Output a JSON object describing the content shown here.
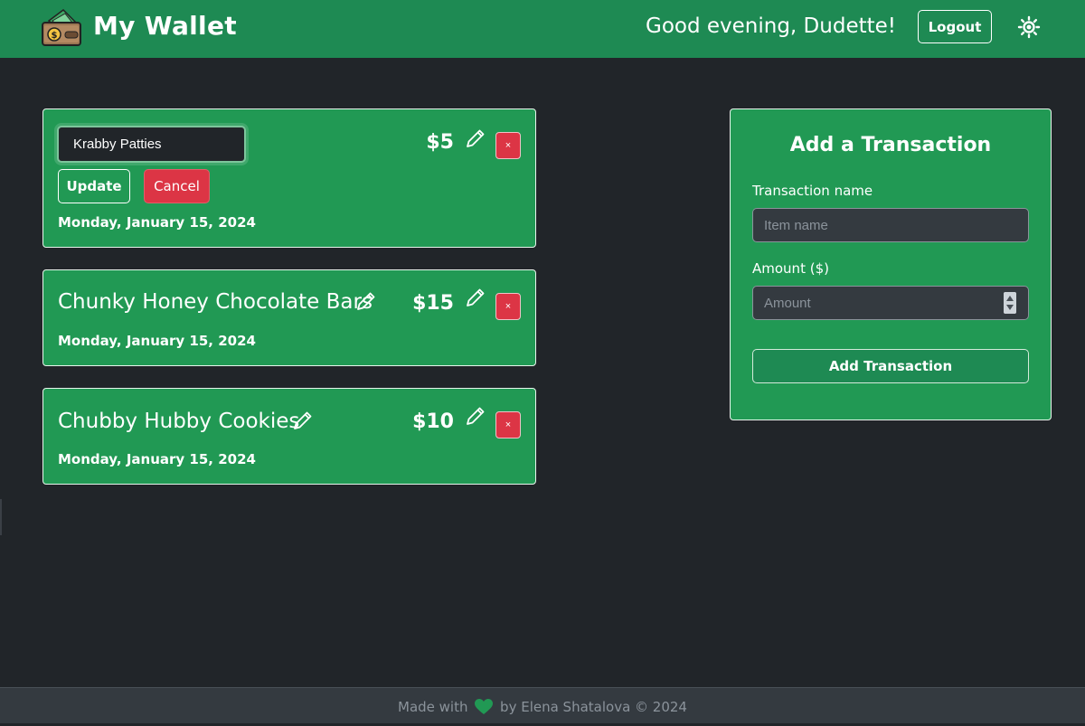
{
  "header": {
    "logo_icon": "wallet-icon",
    "title": "My Wallet",
    "greeting": "Good evening, Dudette!",
    "logout_label": "Logout",
    "theme_icon": "sun-icon",
    "bg_color": "#1e8a53"
  },
  "transactions": [
    {
      "editing": true,
      "name_input_value": "Krabby Patties",
      "update_label": "Update",
      "cancel_label": "Cancel",
      "amount": "$5",
      "delete_label": "×",
      "date": "Monday, January 15, 2024"
    },
    {
      "editing": false,
      "name": "Chunky Honey Chocolate Bars",
      "amount": "$15",
      "delete_label": "×",
      "date": "Monday, January 15, 2024"
    },
    {
      "editing": false,
      "name": "Chubby Hubby Cookies",
      "amount": "$10",
      "delete_label": "×",
      "date": "Monday, January 15, 2024"
    }
  ],
  "add_form": {
    "title": "Add a Transaction",
    "name_label": "Transaction name",
    "name_placeholder": "Item name",
    "amount_label": "Amount ($)",
    "amount_placeholder": "Amount",
    "submit_label": "Add Transaction"
  },
  "footer": {
    "text_before": "Made with",
    "heart_icon": "heart-icon",
    "text_after": "by Elena Shatalova © 2024"
  },
  "colors": {
    "background": "#212529",
    "card": "#219954",
    "danger": "#dc3545",
    "footer": "#343a40"
  }
}
